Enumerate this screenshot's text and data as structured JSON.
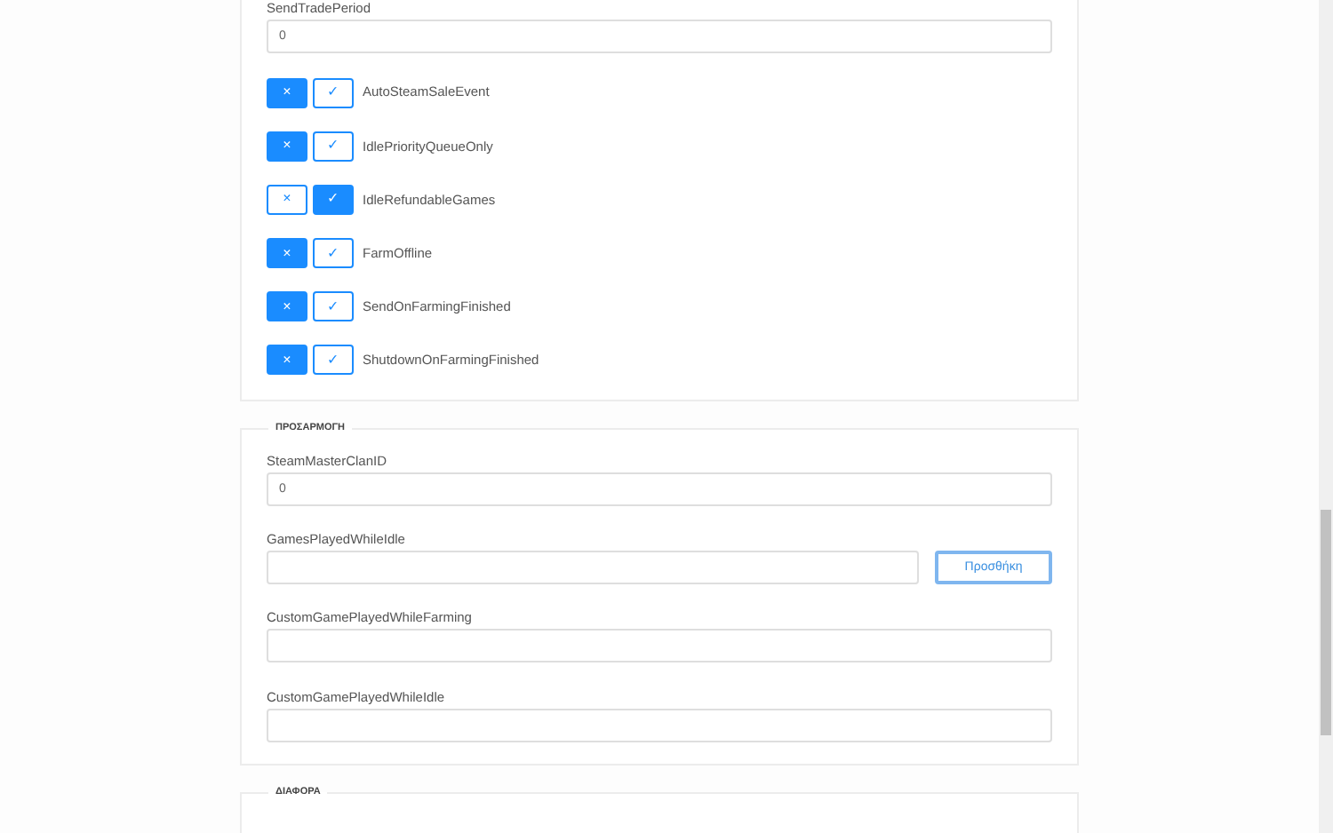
{
  "general": {
    "send_trade_period": {
      "label": "SendTradePeriod",
      "value": "0"
    },
    "toggles": [
      {
        "label": "AutoSteamSaleEvent",
        "checked": false,
        "off_label": "×",
        "on_label": "✓"
      },
      {
        "label": "IdlePriorityQueueOnly",
        "checked": false,
        "off_label": "×",
        "on_label": "✓"
      },
      {
        "label": "IdleRefundableGames",
        "checked": true,
        "off_label": "×",
        "on_label": "✓"
      },
      {
        "label": "FarmOffline",
        "checked": false,
        "off_label": "×",
        "on_label": "✓"
      },
      {
        "label": "SendOnFarmingFinished",
        "checked": false,
        "off_label": "×",
        "on_label": "✓"
      },
      {
        "label": "ShutdownOnFarmingFinished",
        "checked": false,
        "off_label": "×",
        "on_label": "✓"
      }
    ]
  },
  "customization": {
    "legend": "ΠΡΟΣΑΡΜΟΓΗ",
    "steam_master_clan_id": {
      "label": "SteamMasterClanID",
      "value": "0"
    },
    "games_played_while_idle": {
      "label": "GamesPlayedWhileIdle",
      "button": "Προσθήκη"
    },
    "custom_game_played_while_farming": {
      "label": "CustomGamePlayedWhileFarming"
    },
    "custom_game_played_while_idle": {
      "label": "CustomGamePlayedWhileIdle"
    }
  },
  "misc": {
    "legend": "ΔΙΑΦΟΡΑ"
  }
}
